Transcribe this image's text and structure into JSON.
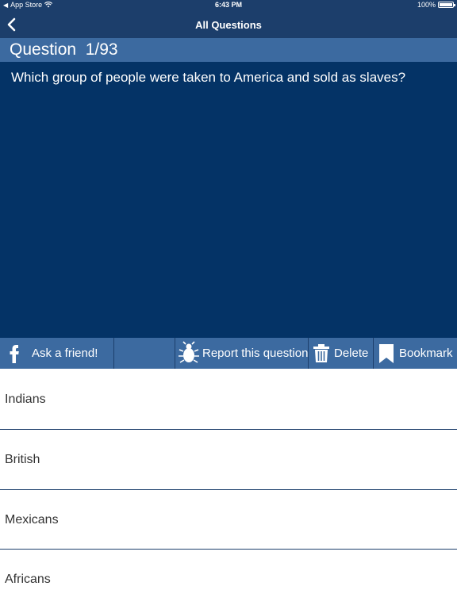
{
  "status_bar": {
    "back_app": "App Store",
    "time": "6:43 PM",
    "battery": "100%",
    "battery_level": 1.0
  },
  "nav": {
    "title": "All Questions",
    "back_icon": "chevron-left-icon"
  },
  "question": {
    "label": "Question",
    "counter": "1/93",
    "text": "Which group of people were taken to America and sold as slaves?"
  },
  "toolbar": {
    "ask_friend": "Ask a friend!",
    "report": "Report this question",
    "delete": "Delete",
    "bookmark": "Bookmark",
    "icons": [
      "facebook-icon",
      "bug-icon",
      "trash-icon",
      "bookmark-icon"
    ]
  },
  "answers": [
    {
      "text": "Indians"
    },
    {
      "text": "British"
    },
    {
      "text": "Mexicans"
    },
    {
      "text": "Africans"
    }
  ],
  "colors": {
    "nav_bg": "#1c3e6b",
    "header_bg": "#3c6aa0",
    "question_bg": "#043366",
    "answer_bg": "#ffffff",
    "answer_text": "#333333"
  }
}
